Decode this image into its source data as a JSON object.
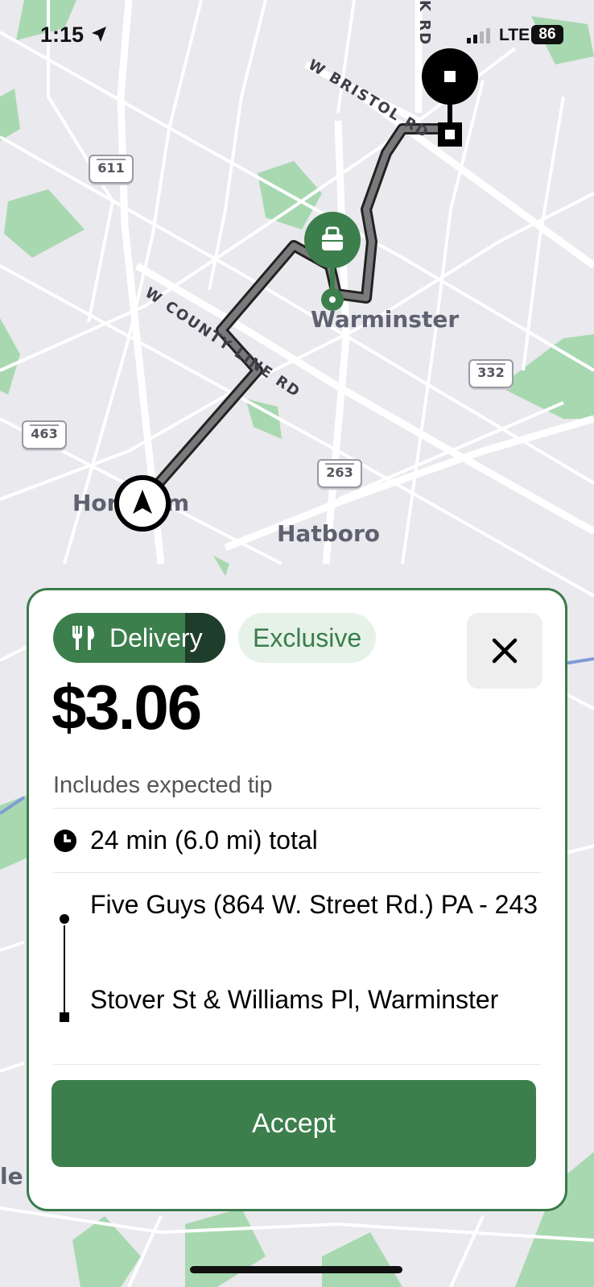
{
  "status_bar": {
    "time": "1:15",
    "network": "LTE",
    "battery": "86"
  },
  "map": {
    "towns": [
      "Warminster",
      "Hatboro",
      "Hor",
      "m",
      "le"
    ],
    "roads": [
      "W BRISTOL RD",
      "W COUNTY LINE RD",
      "K RD"
    ],
    "route_shields": [
      "611",
      "332",
      "463",
      "263"
    ],
    "colors": {
      "route": "#4a4a4a",
      "park": "#a8d8b0",
      "accent": "#3c7f4c"
    }
  },
  "offer": {
    "type_label": "Delivery",
    "badge_label": "Exclusive",
    "price": "$3.06",
    "price_note": "Includes expected tip",
    "duration": "24 min (6.0 mi) total",
    "pickup": "Five Guys (864 W. Street Rd.) PA - 243",
    "dropoff": "Stover St & Williams Pl, Warminster",
    "accept_label": "Accept"
  },
  "icons": {
    "location_arrow": "location-arrow-icon",
    "utensils": "utensils-icon",
    "close": "close-icon",
    "clock": "clock-icon",
    "bag": "bag-icon",
    "navigation": "navigation-arrow-icon"
  }
}
